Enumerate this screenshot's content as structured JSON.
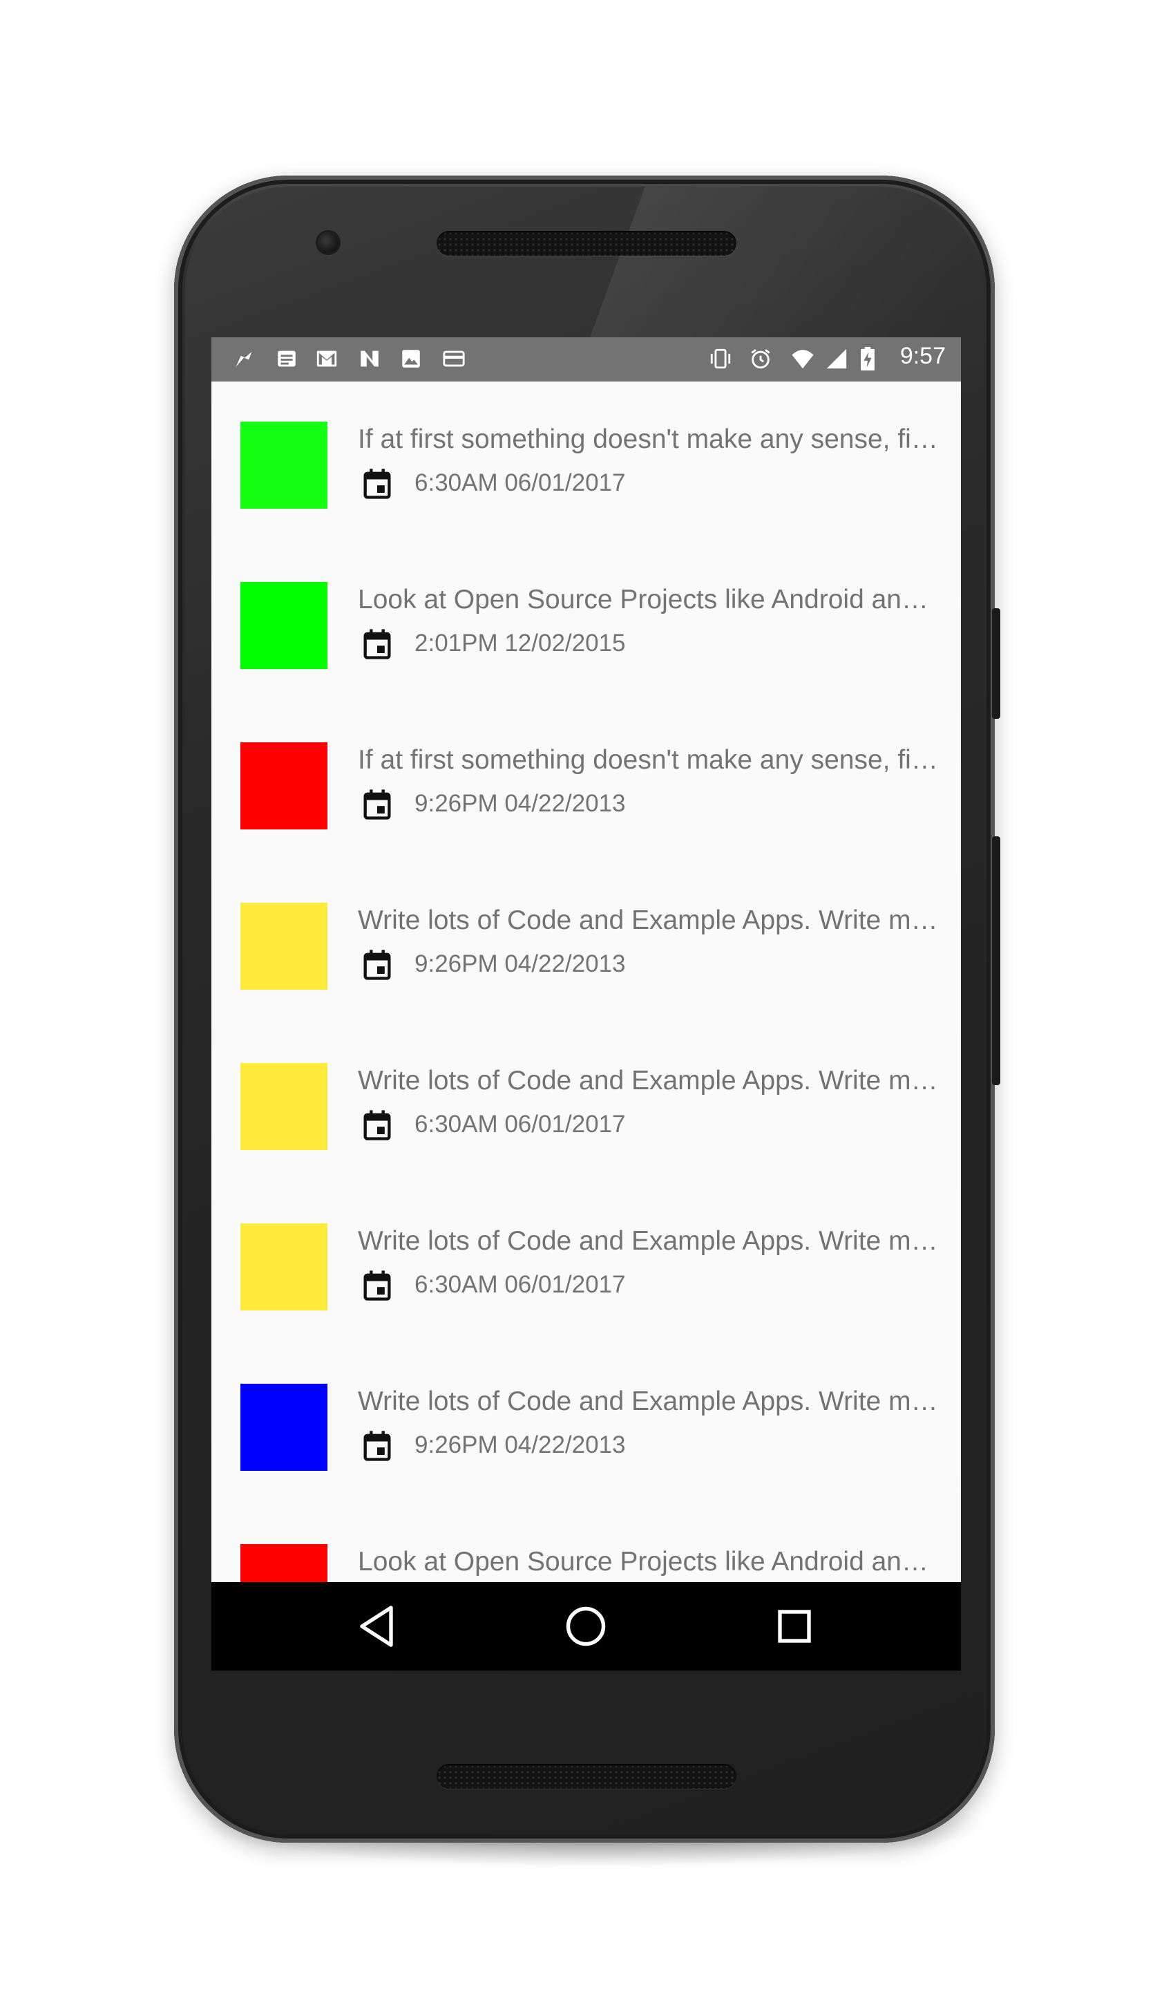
{
  "status_bar": {
    "time": "9:57",
    "left_icons": [
      "notification-flag-icon",
      "newspaper-icon",
      "gmail-icon",
      "n-app-icon",
      "image-icon",
      "card-icon"
    ],
    "right_icons": [
      "vibrate-icon",
      "alarm-icon",
      "wifi-icon",
      "signal-icon",
      "battery-charging-icon"
    ]
  },
  "items": [
    {
      "title": "If at first something doesn't make any sense, find out why",
      "date": "6:30AM 06/01/2017",
      "color": "#14ff14"
    },
    {
      "title": "Look at Open Source Projects like Android and Linux",
      "date": "2:01PM 12/02/2015",
      "color": "#00ff00"
    },
    {
      "title": "If at first something doesn't make any sense, find out why",
      "date": "9:26PM 04/22/2013",
      "color": "#ff0000"
    },
    {
      "title": "Write lots of Code and Example Apps. Write more",
      "date": "9:26PM 04/22/2013",
      "color": "#ffeb3b"
    },
    {
      "title": "Write lots of Code and Example Apps. Write more",
      "date": "6:30AM 06/01/2017",
      "color": "#ffeb3b"
    },
    {
      "title": "Write lots of Code and Example Apps. Write more",
      "date": "6:30AM 06/01/2017",
      "color": "#ffeb3b"
    },
    {
      "title": "Write lots of Code and Example Apps. Write more",
      "date": "9:26PM 04/22/2013",
      "color": "#0000ff"
    },
    {
      "title": "Look at Open Source Projects like Android and Linux",
      "date": "",
      "color": "#ff0000"
    }
  ],
  "nav": {
    "back": "back-icon",
    "home": "home-icon",
    "recents": "recents-icon"
  }
}
